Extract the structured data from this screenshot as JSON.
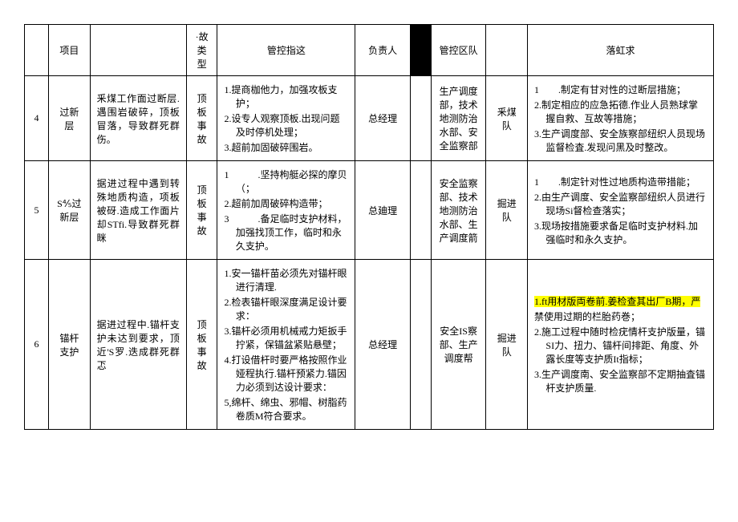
{
  "headers": {
    "project": "项目",
    "accidentType": "·故类型",
    "controlPointer": "管控指这",
    "responsible": "负责人",
    "controlTeam": "管控区队",
    "implement": "落虹求"
  },
  "rows": [
    {
      "idx": "4",
      "project": "过新层",
      "desc": "釆煤工作面过断层.遇围岩破碎，顶板冒落，导致群死群伤。",
      "type": "顶板事故",
      "control": [
        "1.提商枷他力，加强攻板支护；",
        "2.设专人观察顶板.出现问题及时停机处理；",
        "3.超前加固破碎围岩。"
      ],
      "owner": "总经理",
      "dept": "生产调度部，技术地测防治水部、安全监察部",
      "team": "釆煤队",
      "impl": [
        "1　　.制定有甘对性的过断层措施；",
        "2.制定相应的应急拓德.作业人员熟球掌握自救、互故等措施；",
        "3.生产调度部、安全族察部纽织人员现场监督检査.发现问黑及时整改。"
      ]
    },
    {
      "idx": "5",
      "project": "S⅘过新层",
      "desc": "据进过程中遇到转殊地质构造，项板被砑.造成工作面片却STfi.导致群死群眯",
      "type": "顶板事故",
      "control": [
        "1　　　.坚持枸艇必探的摩贝（；",
        "2.超前加周破碎构造带；",
        "3　　　.备足临时支护材料，加强找顶工作，临时和永久支护。"
      ],
      "owner": "总廸理",
      "dept": "安全监察部、技术地测防治水部、生产调度箭",
      "team": "掘进队",
      "impl": [
        "1　　.制定针对性过地质构造带措能；",
        "2.由生产调度、安全监察部纽织人员进行现场Si督检查落实；",
        "3.现场按措施要求备足临时支护材料.加强临时和永久支护。"
      ]
    },
    {
      "idx": "6",
      "project": "锚杆支护",
      "desc": "据进过程中.锚杆支护未达到要求，顶近'S罗.迭成群死群忑",
      "type": "顶板事故",
      "control": [
        "1.安一锚杆苗必须先对锚杆眼进行清理.",
        "2.检表锚杆眼深度满足设计要求：",
        "3.锚杆必须用机械戒力矩扳手拧紧，保锚盆紧贴悬壁；",
        "4.打设借杆时要严格按照作业娅程执行.锚杆预紧力.锚因力必须到达设计要求：",
        "5,绵杆、绵虫、邪帽、树脂药卷质M符合要求。"
      ],
      "owner": "总经理",
      "dept": "安全IS察部、生产调度帮",
      "team": "掘进队",
      "impl": [
        {
          "text": "1.ft用材版両卷前.姜检查其出厂B期，严",
          "hl": true
        },
        {
          "text": "禁使用过期的栏胎药巻；",
          "hl": false
        },
        {
          "text": "2.施工过程中随时检疣情杆支护版量，锚SI力、扭力、锚杆间排距、角度、外露长度等支护质It指标；",
          "hl": false
        },
        {
          "text": "3.生产调度南、安全监察部不定期抽査锚杆支护质量.",
          "hl": false
        }
      ]
    }
  ]
}
